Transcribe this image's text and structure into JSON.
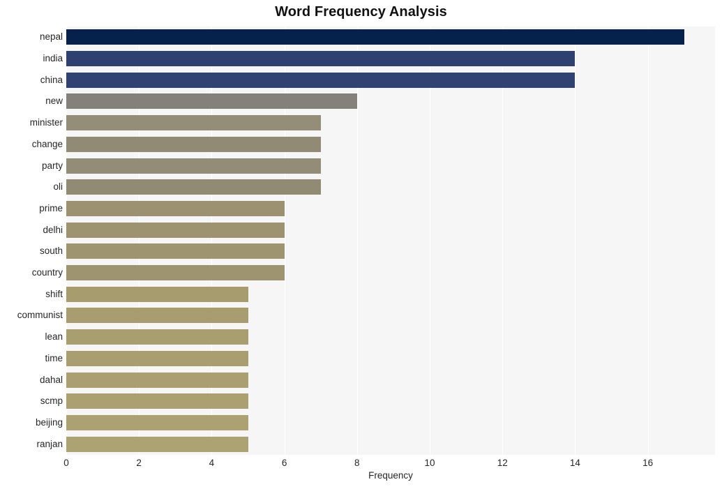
{
  "chart_data": {
    "type": "bar",
    "orientation": "horizontal",
    "title": "Word Frequency Analysis",
    "xlabel": "Frequency",
    "ylabel": "",
    "xlim": [
      0,
      17.85
    ],
    "xticks": [
      0,
      2,
      4,
      6,
      8,
      10,
      12,
      14,
      16
    ],
    "xtick_labels": [
      "0",
      "2",
      "4",
      "6",
      "8",
      "10",
      "12",
      "14",
      "16"
    ],
    "grid": "vertical-white",
    "legend": "none",
    "categories": [
      "nepal",
      "india",
      "china",
      "new",
      "minister",
      "change",
      "party",
      "oli",
      "prime",
      "delhi",
      "south",
      "country",
      "shift",
      "communist",
      "lean",
      "time",
      "dahal",
      "scmp",
      "beijing",
      "ranjan"
    ],
    "values": [
      17,
      14,
      14,
      8,
      7,
      7,
      7,
      7,
      6,
      6,
      6,
      6,
      5,
      5,
      5,
      5,
      5,
      5,
      5,
      5
    ],
    "bar_colors": [
      "#06224c",
      "#2e4070",
      "#304271",
      "#83817a",
      "#948e79",
      "#918b75",
      "#938d77",
      "#918b73",
      "#9c9271",
      "#9d9370",
      "#9e9470",
      "#9e9470",
      "#a69c6e",
      "#a79d6f",
      "#a89e6f",
      "#a89e6f",
      "#a99f70",
      "#aaa070",
      "#aba171",
      "#ada271"
    ],
    "plot_background": "#f6f6f7",
    "figure_background": "#ffffff",
    "gridline_color": "#ffffff"
  }
}
